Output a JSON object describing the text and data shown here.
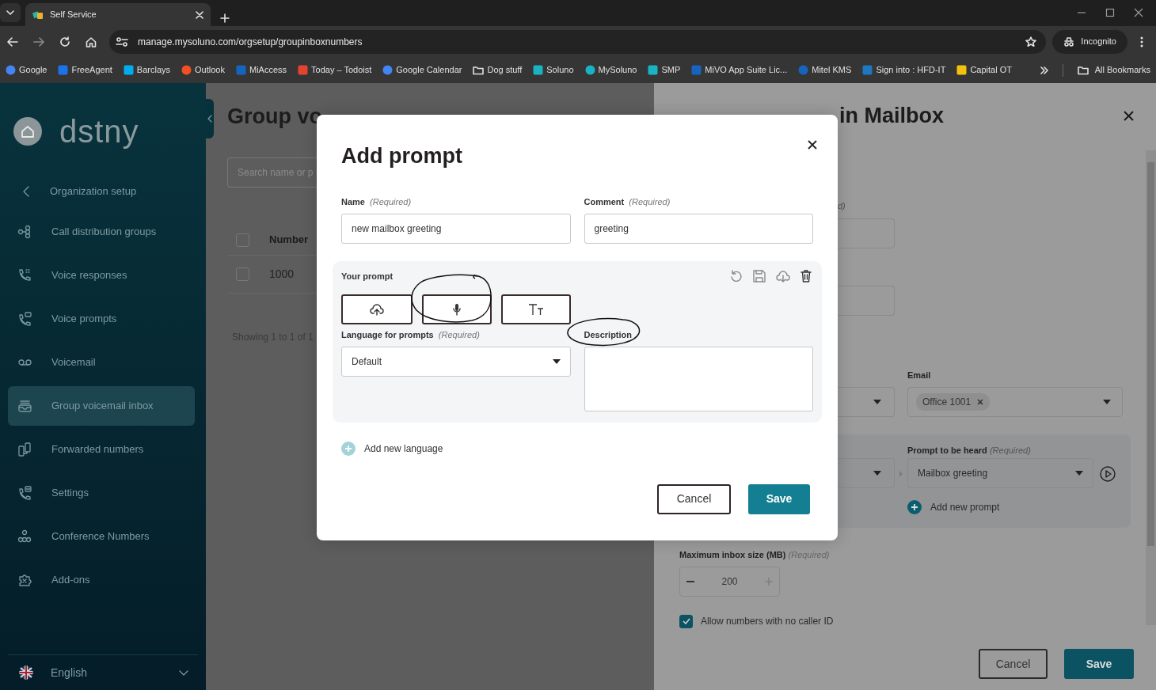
{
  "browser": {
    "tab_title": "Self Service",
    "url": "manage.mysoluno.com/orgsetup/groupinboxnumbers",
    "profile": "Incognito",
    "bookmarks": [
      {
        "label": "Google",
        "kind": "site"
      },
      {
        "label": "FreeAgent",
        "kind": "site"
      },
      {
        "label": "Barclays",
        "kind": "site"
      },
      {
        "label": "Outlook",
        "kind": "site"
      },
      {
        "label": "MiAccess",
        "kind": "site"
      },
      {
        "label": "Today – Todoist",
        "kind": "site"
      },
      {
        "label": "Google Calendar",
        "kind": "site"
      },
      {
        "label": "Dog stuff",
        "kind": "folder"
      },
      {
        "label": "Soluno",
        "kind": "site"
      },
      {
        "label": "MySoluno",
        "kind": "site"
      },
      {
        "label": "SMP",
        "kind": "site"
      },
      {
        "label": "MiVO App Suite Lic...",
        "kind": "site"
      },
      {
        "label": "Mitel KMS",
        "kind": "site"
      },
      {
        "label": "Sign into : HFD-IT",
        "kind": "site"
      },
      {
        "label": "Capital OT",
        "kind": "site"
      }
    ],
    "all_bookmarks": "All Bookmarks"
  },
  "sidebar": {
    "logo": "dstny",
    "section": "Organization setup",
    "items": [
      {
        "label": "Call distribution groups",
        "selected": false
      },
      {
        "label": "Voice responses",
        "selected": false
      },
      {
        "label": "Voice prompts",
        "selected": false
      },
      {
        "label": "Voicemail",
        "selected": false
      },
      {
        "label": "Group voicemail inbox",
        "selected": true
      },
      {
        "label": "Forwarded numbers",
        "selected": false
      },
      {
        "label": "Settings",
        "selected": false
      },
      {
        "label": "Conference Numbers",
        "selected": false
      },
      {
        "label": "Add-ons",
        "selected": false
      }
    ],
    "language": "English"
  },
  "page": {
    "title": "Group vo",
    "search_placeholder": "Search name or p",
    "table": {
      "columns": [
        "Number"
      ],
      "header_checked": false,
      "rows": [
        {
          "number": "1000",
          "checked": false
        }
      ]
    },
    "footer": "Showing 1 to 1 of 1"
  },
  "edit_panel": {
    "title": "in Mailbox",
    "label_fragment": "d)",
    "email_label": "Email",
    "email_chip": "Office 1001",
    "prompt_label": "Prompt to be heard",
    "prompt_required": "(Required)",
    "prompt_value": "Mailbox greeting",
    "add_prompt": "Add new prompt",
    "max_label": "Maximum inbox size (MB)",
    "max_required": "(Required)",
    "max_value": "200",
    "allow": {
      "label": "Allow numbers with no caller ID",
      "checked": true
    },
    "buttons": [
      "Cancel",
      "Save"
    ]
  },
  "modal": {
    "title": "Add prompt",
    "fields": [
      {
        "label": "Name",
        "required": "(Required)",
        "value": "new mailbox greeting"
      },
      {
        "label": "Comment",
        "required": "(Required)",
        "value": "greeting"
      }
    ],
    "prompt": {
      "label": "Your prompt",
      "language_label": "Language for prompts",
      "language_required": "(Required)",
      "language_value": "Default",
      "description_label": "Description"
    },
    "add_language": "Add new language",
    "buttons": [
      "Cancel",
      "Save"
    ]
  }
}
